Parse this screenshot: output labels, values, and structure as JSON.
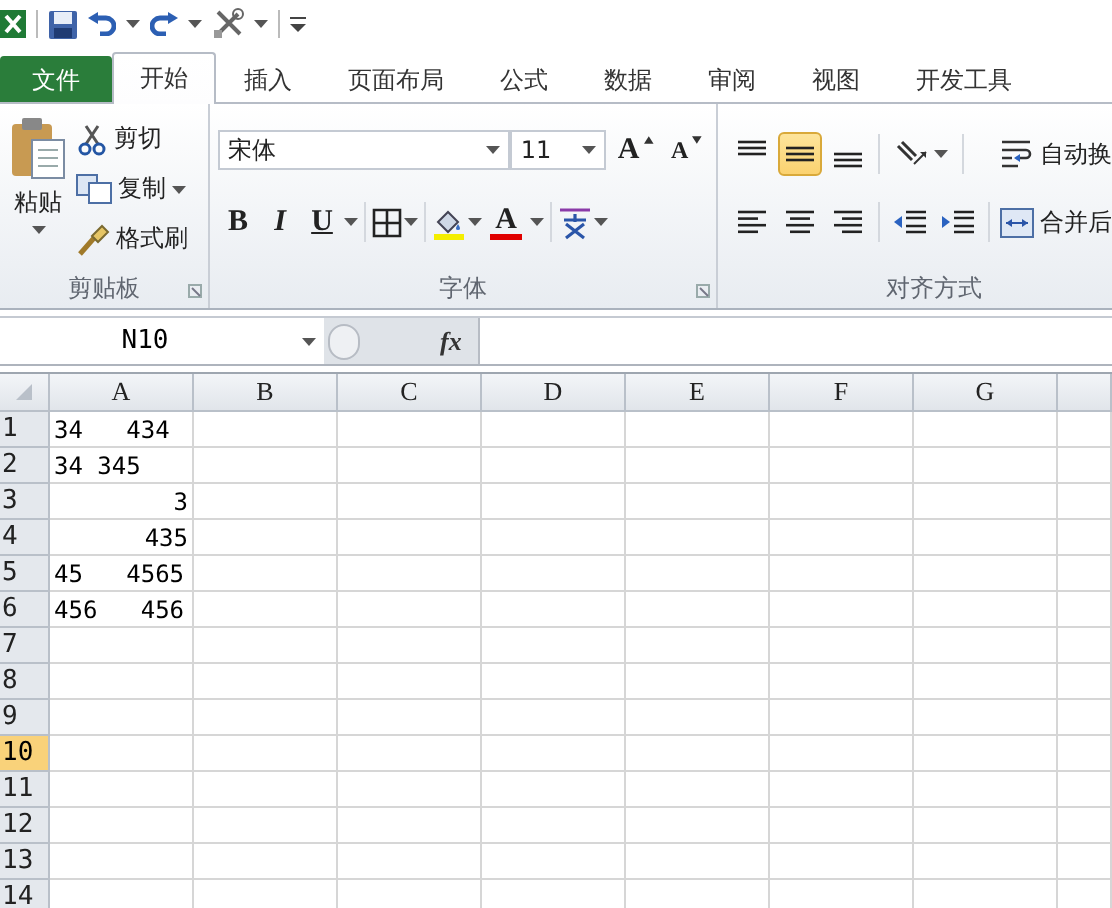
{
  "tabs": [
    {
      "label": "文件",
      "kind": "file",
      "selected": false
    },
    {
      "label": "开始",
      "kind": "tab",
      "selected": true
    },
    {
      "label": "插入",
      "kind": "tab",
      "selected": false
    },
    {
      "label": "页面布局",
      "kind": "tab",
      "selected": false
    },
    {
      "label": "公式",
      "kind": "tab",
      "selected": false
    },
    {
      "label": "数据",
      "kind": "tab",
      "selected": false
    },
    {
      "label": "审阅",
      "kind": "tab",
      "selected": false
    },
    {
      "label": "视图",
      "kind": "tab",
      "selected": false
    },
    {
      "label": "开发工具",
      "kind": "tab",
      "selected": false
    }
  ],
  "ribbon": {
    "clipboard": {
      "title": "剪贴板",
      "paste": "粘贴",
      "cut": "剪切",
      "copy": "复制",
      "format_painter": "格式刷"
    },
    "font": {
      "title": "字体",
      "font_name": "宋体",
      "font_size": "11",
      "grow_font": "A",
      "shrink_font": "A",
      "bold": "B",
      "italic": "I",
      "underline": "U",
      "font_color": "A"
    },
    "alignment": {
      "title": "对齐方式",
      "vertical_align": [
        {
          "kind": "top",
          "selected": false
        },
        {
          "kind": "middle",
          "selected": true
        },
        {
          "kind": "bottom",
          "selected": false
        }
      ],
      "wrap_text": "自动换",
      "merge": "合并后"
    }
  },
  "formula_bar": {
    "name_box": "N10",
    "function_button": "fx"
  },
  "sheet": {
    "columns": [
      {
        "label": "A"
      },
      {
        "label": "B"
      },
      {
        "label": "C"
      },
      {
        "label": "D"
      },
      {
        "label": "E"
      },
      {
        "label": "F"
      },
      {
        "label": "G"
      }
    ],
    "rows": [
      {
        "label": "1",
        "selected": false,
        "cells": [
          {
            "value": "34   434",
            "kind": "text"
          }
        ]
      },
      {
        "label": "2",
        "selected": false,
        "cells": [
          {
            "value": "34 345",
            "kind": "text"
          }
        ]
      },
      {
        "label": "3",
        "selected": false,
        "cells": [
          {
            "value": "3",
            "kind": "number"
          }
        ]
      },
      {
        "label": "4",
        "selected": false,
        "cells": [
          {
            "value": "435",
            "kind": "number"
          }
        ]
      },
      {
        "label": "5",
        "selected": false,
        "cells": [
          {
            "value": "45   4565",
            "kind": "text"
          }
        ]
      },
      {
        "label": "6",
        "selected": false,
        "cells": [
          {
            "value": "456   456",
            "kind": "text"
          }
        ]
      },
      {
        "label": "7",
        "selected": false,
        "cells": []
      },
      {
        "label": "8",
        "selected": false,
        "cells": []
      },
      {
        "label": "9",
        "selected": false,
        "cells": []
      },
      {
        "label": "10",
        "selected": true,
        "cells": []
      },
      {
        "label": "11",
        "selected": false,
        "cells": []
      },
      {
        "label": "12",
        "selected": false,
        "cells": []
      },
      {
        "label": "13",
        "selected": false,
        "cells": []
      },
      {
        "label": "14",
        "selected": false,
        "cells": []
      }
    ]
  }
}
